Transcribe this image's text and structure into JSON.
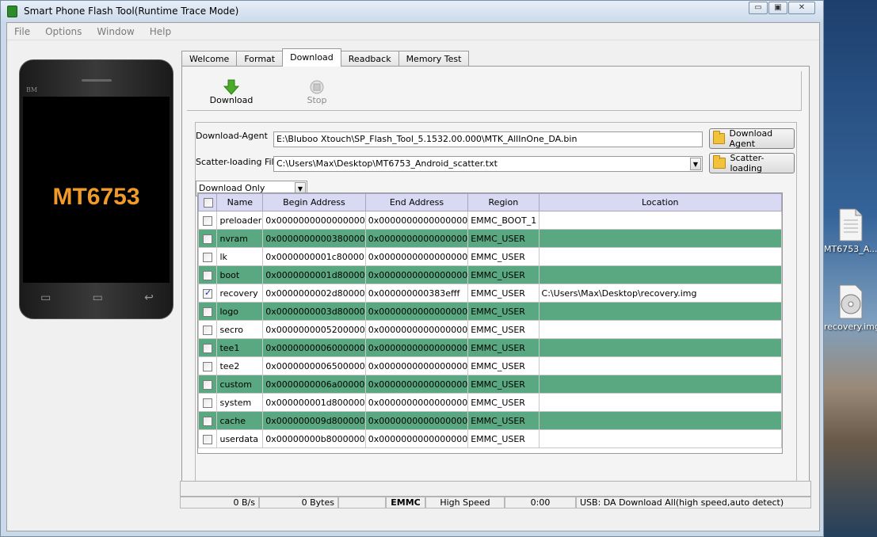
{
  "window": {
    "title": "Smart Phone Flash Tool(Runtime Trace Mode)",
    "minimize": "▭",
    "maximize": "▣",
    "close": "✕"
  },
  "menu": [
    "File",
    "Options",
    "Window",
    "Help"
  ],
  "phone": {
    "brand": "BM",
    "chip": "MT6753",
    "keys": [
      "▭",
      "▭",
      "↩"
    ]
  },
  "tabs": [
    "Welcome",
    "Format",
    "Download",
    "Readback",
    "Memory Test"
  ],
  "active_tab": "Download",
  "toolbar": {
    "download_label": "Download",
    "stop_label": "Stop"
  },
  "download_agent": {
    "label": "Download-Agent",
    "value": "E:\\Bluboo Xtouch\\SP_Flash_Tool_5.1532.00.000\\MTK_AllInOne_DA.bin",
    "button": "Download Agent"
  },
  "scatter": {
    "label": "Scatter-loading File",
    "value": "C:\\Users\\Max\\Desktop\\MT6753_Android_scatter.txt",
    "button": "Scatter-loading"
  },
  "mode": {
    "value": "Download Only"
  },
  "table": {
    "headers": [
      "",
      "Name",
      "Begin Address",
      "End Address",
      "Region",
      "Location"
    ],
    "rows": [
      {
        "checked": false,
        "name": "preloader",
        "begin": "0x0000000000000000",
        "end": "0x0000000000000000",
        "region": "EMMC_BOOT_1",
        "location": ""
      },
      {
        "checked": false,
        "name": "nvram",
        "begin": "0x0000000000380000",
        "end": "0x0000000000000000",
        "region": "EMMC_USER",
        "location": ""
      },
      {
        "checked": false,
        "name": "lk",
        "begin": "0x0000000001c80000",
        "end": "0x0000000000000000",
        "region": "EMMC_USER",
        "location": ""
      },
      {
        "checked": false,
        "name": "boot",
        "begin": "0x0000000001d80000",
        "end": "0x0000000000000000",
        "region": "EMMC_USER",
        "location": ""
      },
      {
        "checked": true,
        "name": "recovery",
        "begin": "0x0000000002d80000",
        "end": "0x000000000383efff",
        "region": "EMMC_USER",
        "location": "C:\\Users\\Max\\Desktop\\recovery.img"
      },
      {
        "checked": false,
        "name": "logo",
        "begin": "0x0000000003d80000",
        "end": "0x0000000000000000",
        "region": "EMMC_USER",
        "location": ""
      },
      {
        "checked": false,
        "name": "secro",
        "begin": "0x0000000005200000",
        "end": "0x0000000000000000",
        "region": "EMMC_USER",
        "location": ""
      },
      {
        "checked": false,
        "name": "tee1",
        "begin": "0x0000000006000000",
        "end": "0x0000000000000000",
        "region": "EMMC_USER",
        "location": ""
      },
      {
        "checked": false,
        "name": "tee2",
        "begin": "0x0000000006500000",
        "end": "0x0000000000000000",
        "region": "EMMC_USER",
        "location": ""
      },
      {
        "checked": false,
        "name": "custom",
        "begin": "0x0000000006a00000",
        "end": "0x0000000000000000",
        "region": "EMMC_USER",
        "location": ""
      },
      {
        "checked": false,
        "name": "system",
        "begin": "0x000000001d800000",
        "end": "0x0000000000000000",
        "region": "EMMC_USER",
        "location": ""
      },
      {
        "checked": false,
        "name": "cache",
        "begin": "0x000000009d800000",
        "end": "0x0000000000000000",
        "region": "EMMC_USER",
        "location": ""
      },
      {
        "checked": false,
        "name": "userdata",
        "begin": "0x00000000b8000000",
        "end": "0x0000000000000000",
        "region": "EMMC_USER",
        "location": ""
      }
    ]
  },
  "status": {
    "speed": "0 B/s",
    "bytes": "0 Bytes",
    "storage": "EMMC",
    "mode": "High Speed",
    "time": "0:00",
    "message": "USB: DA Download All(high speed,auto detect)"
  },
  "desktop": {
    "file1": "MT6753_A...",
    "file2": "recovery.img"
  },
  "colors": {
    "row_alt": "#5aa882",
    "header": "#d9d9f3",
    "download_arrow": "#4caa2a",
    "chip_text": "#f09a2a"
  }
}
